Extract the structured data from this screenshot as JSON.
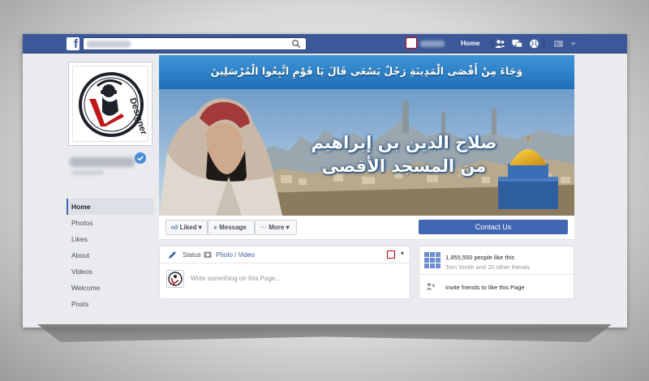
{
  "topbar": {
    "logo": "f",
    "home_label": "Home",
    "icons": [
      "friends-icon",
      "messages-icon",
      "globe-icon",
      "account-icon",
      "chevron-down-icon"
    ]
  },
  "cover": {
    "banner_text": "وَجَاءَ مِنْ أَقْصَى الْمَدِينَةِ رَجُلٌ يَسْعَى قَالَ يَا قَوْمِ اتَّبِعُوا الْمُرْسَلِينَ",
    "title_line1": "صلاح الدين بن إبراهيم",
    "title_line2": "من المسجد الأقصى"
  },
  "profile": {
    "logo_text": "Designer"
  },
  "nav": {
    "items": [
      "Home",
      "Photos",
      "Likes",
      "About",
      "Videos",
      "Welcome",
      "Posts"
    ],
    "active": "Home"
  },
  "actions": {
    "liked": "Liked",
    "message": "Message",
    "more": "More",
    "contact": "Contact Us"
  },
  "composer": {
    "status": "Status",
    "photo_video": "Photo / Video",
    "placeholder": "Write something on this Page..."
  },
  "likes_box": {
    "count": "1,955,550 people like this",
    "friends": "Tom Smith and 20 other friends",
    "invite": "Invite friends to like this Page"
  },
  "colors": {
    "facebook_blue": "#3b5998",
    "button_blue": "#4267b2",
    "banner_blue": "#1f6fb8",
    "page_bg": "#e9ebee"
  }
}
